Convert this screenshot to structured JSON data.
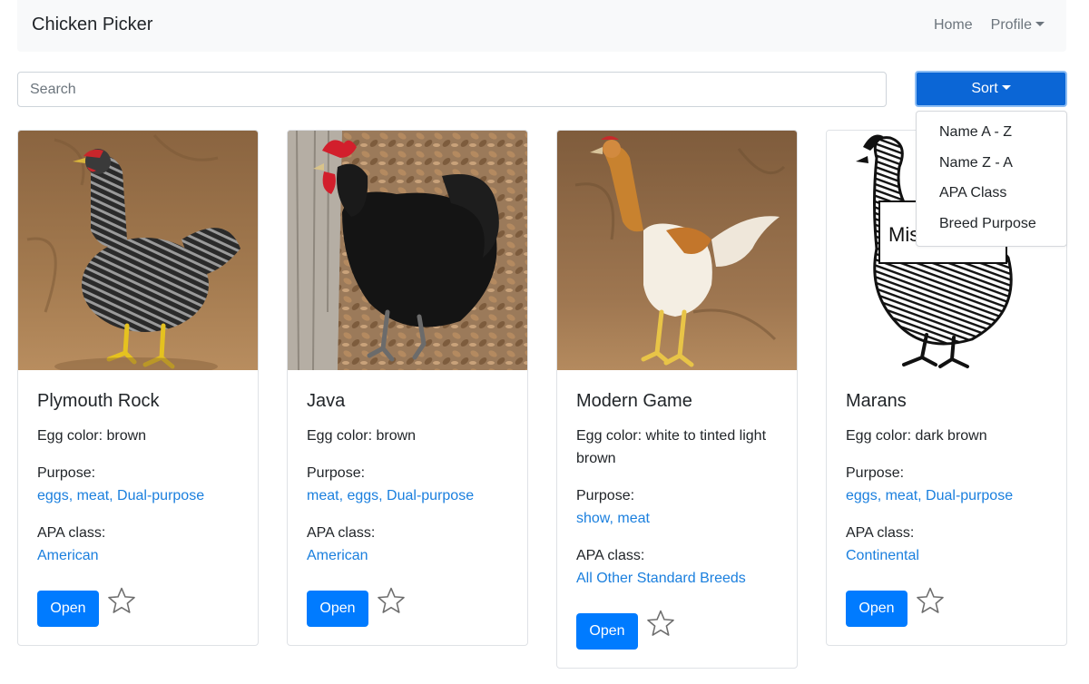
{
  "navbar": {
    "brand": "Chicken Picker",
    "home_label": "Home",
    "profile_label": "Profile"
  },
  "search": {
    "placeholder": "Search",
    "value": ""
  },
  "sort": {
    "label": "Sort",
    "options": [
      "Name A - Z",
      "Name Z - A",
      "APA Class",
      "Breed Purpose"
    ]
  },
  "cards": [
    {
      "name": "Plymouth Rock",
      "egg_color": "Egg color: brown",
      "purpose_label": "Purpose:",
      "purpose": "eggs, meat, Dual-purpose",
      "apa_label": "APA class:",
      "apa_class": "American",
      "open_label": "Open",
      "favorite": false
    },
    {
      "name": "Java",
      "egg_color": "Egg color: brown",
      "purpose_label": "Purpose:",
      "purpose": "meat, eggs, Dual-purpose",
      "apa_label": "APA class:",
      "apa_class": "American",
      "open_label": "Open",
      "favorite": false
    },
    {
      "name": "Modern Game",
      "egg_color": "Egg color: white to tinted light brown",
      "purpose_label": "Purpose:",
      "purpose": "show, meat",
      "apa_label": "APA class:",
      "apa_class": "All Other Standard Breeds",
      "open_label": "Open",
      "favorite": false
    },
    {
      "name": "Marans",
      "egg_color": "Egg color: dark brown",
      "purpose_label": "Purpose:",
      "purpose": "eggs, meat, Dual-purpose",
      "apa_label": "APA class:",
      "apa_class": "Continental",
      "open_label": "Open",
      "favorite": false,
      "image_sign_text": "Mis"
    }
  ],
  "colors": {
    "primary": "#007bff",
    "link": "#1a7fde",
    "navbar_bg": "#f8f9fa"
  }
}
